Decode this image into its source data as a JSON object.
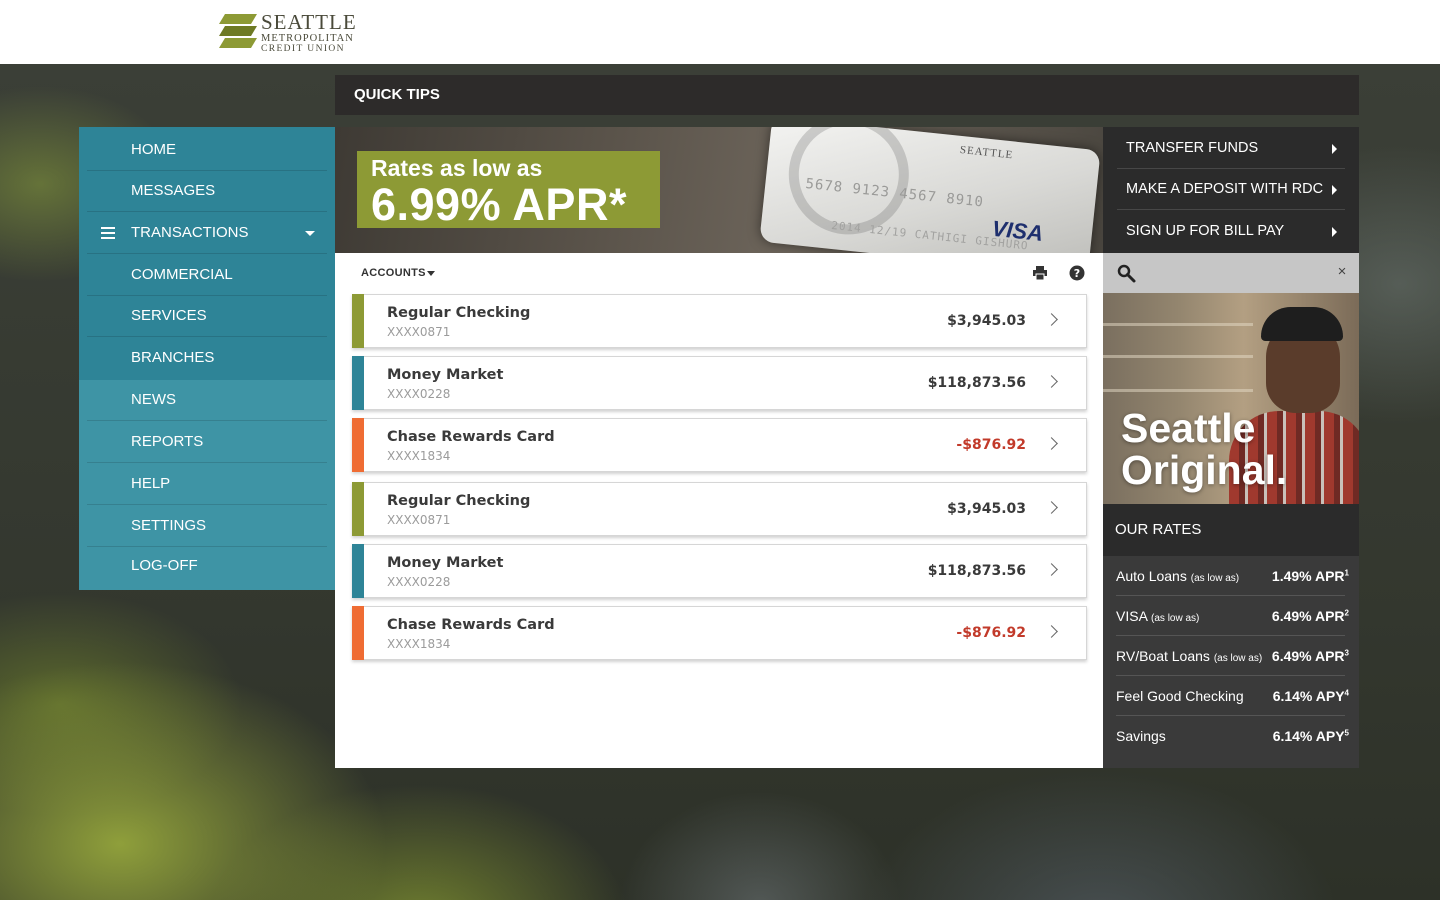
{
  "brand": {
    "line1": "SEATTLE",
    "line2": "METROPOLITAN",
    "line3": "CREDIT UNION",
    "primary_color": "#8d9a35",
    "teal_color": "#2e8497",
    "orange_color": "#ef6c33"
  },
  "quick_tips": {
    "label": "QUICK TIPS"
  },
  "nav": {
    "items": [
      {
        "label": "HOME"
      },
      {
        "label": "MESSAGES"
      },
      {
        "label": "TRANSACTIONS"
      },
      {
        "label": "COMMERCIAL"
      },
      {
        "label": "SERVICES"
      },
      {
        "label": "BRANCHES"
      },
      {
        "label": "NEWS"
      },
      {
        "label": "REPORTS"
      },
      {
        "label": "HELP"
      },
      {
        "label": "SETTINGS"
      },
      {
        "label": "LOG-OFF"
      }
    ]
  },
  "banner": {
    "promo_line1": "Rates as low as",
    "promo_line2": "6.99% APR*",
    "card_number": "5678 9123 4567 8910",
    "card_name": "2014  12/19  CATHIGI GISHURO",
    "card_brand": "VISA",
    "card_logo": "SEATTLE"
  },
  "accounts": {
    "label": "ACCOUNTS",
    "items": [
      {
        "name": "Regular Checking",
        "number": "XXXX0871",
        "balance": "$3,945.03",
        "color": "#8d9a35",
        "negative": false
      },
      {
        "name": "Money Market",
        "number": "XXXX0228",
        "balance": "$118,873.56",
        "color": "#2e8497",
        "negative": false
      },
      {
        "name": "Chase Rewards Card",
        "number": "XXXX1834",
        "balance": "-$876.92",
        "color": "#ef6c33",
        "negative": true
      },
      {
        "name": "Regular Checking",
        "number": "XXXX0871",
        "balance": "$3,945.03",
        "color": "#8d9a35",
        "negative": false
      },
      {
        "name": "Money Market",
        "number": "XXXX0228",
        "balance": "$118,873.56",
        "color": "#2e8497",
        "negative": false
      },
      {
        "name": "Chase Rewards Card",
        "number": "XXXX1834",
        "balance": "-$876.92",
        "color": "#ef6c33",
        "negative": true
      }
    ]
  },
  "quick_actions": {
    "items": [
      {
        "label": "TRANSFER FUNDS"
      },
      {
        "label": "MAKE A DEPOSIT WITH RDC"
      },
      {
        "label": "SIGN UP FOR BILL PAY"
      }
    ]
  },
  "search": {
    "placeholder": "",
    "value": "",
    "close_glyph": "×"
  },
  "photo": {
    "line1": "Seattle",
    "line2": "Original."
  },
  "rates": {
    "title": "OUR RATES",
    "items": [
      {
        "label": "Auto Loans",
        "note": "(as low as)",
        "value": "1.49% APR",
        "footnote": "1"
      },
      {
        "label": "VISA",
        "note": "(as low as)",
        "value": "6.49% APR",
        "footnote": "2"
      },
      {
        "label": "RV/Boat Loans",
        "note": "(as low as)",
        "value": "6.49% APR",
        "footnote": "3"
      },
      {
        "label": "Feel Good Checking",
        "note": "",
        "value": "6.14% APY",
        "footnote": "4"
      },
      {
        "label": "Savings",
        "note": "",
        "value": "6.14% APY",
        "footnote": "5"
      }
    ]
  }
}
